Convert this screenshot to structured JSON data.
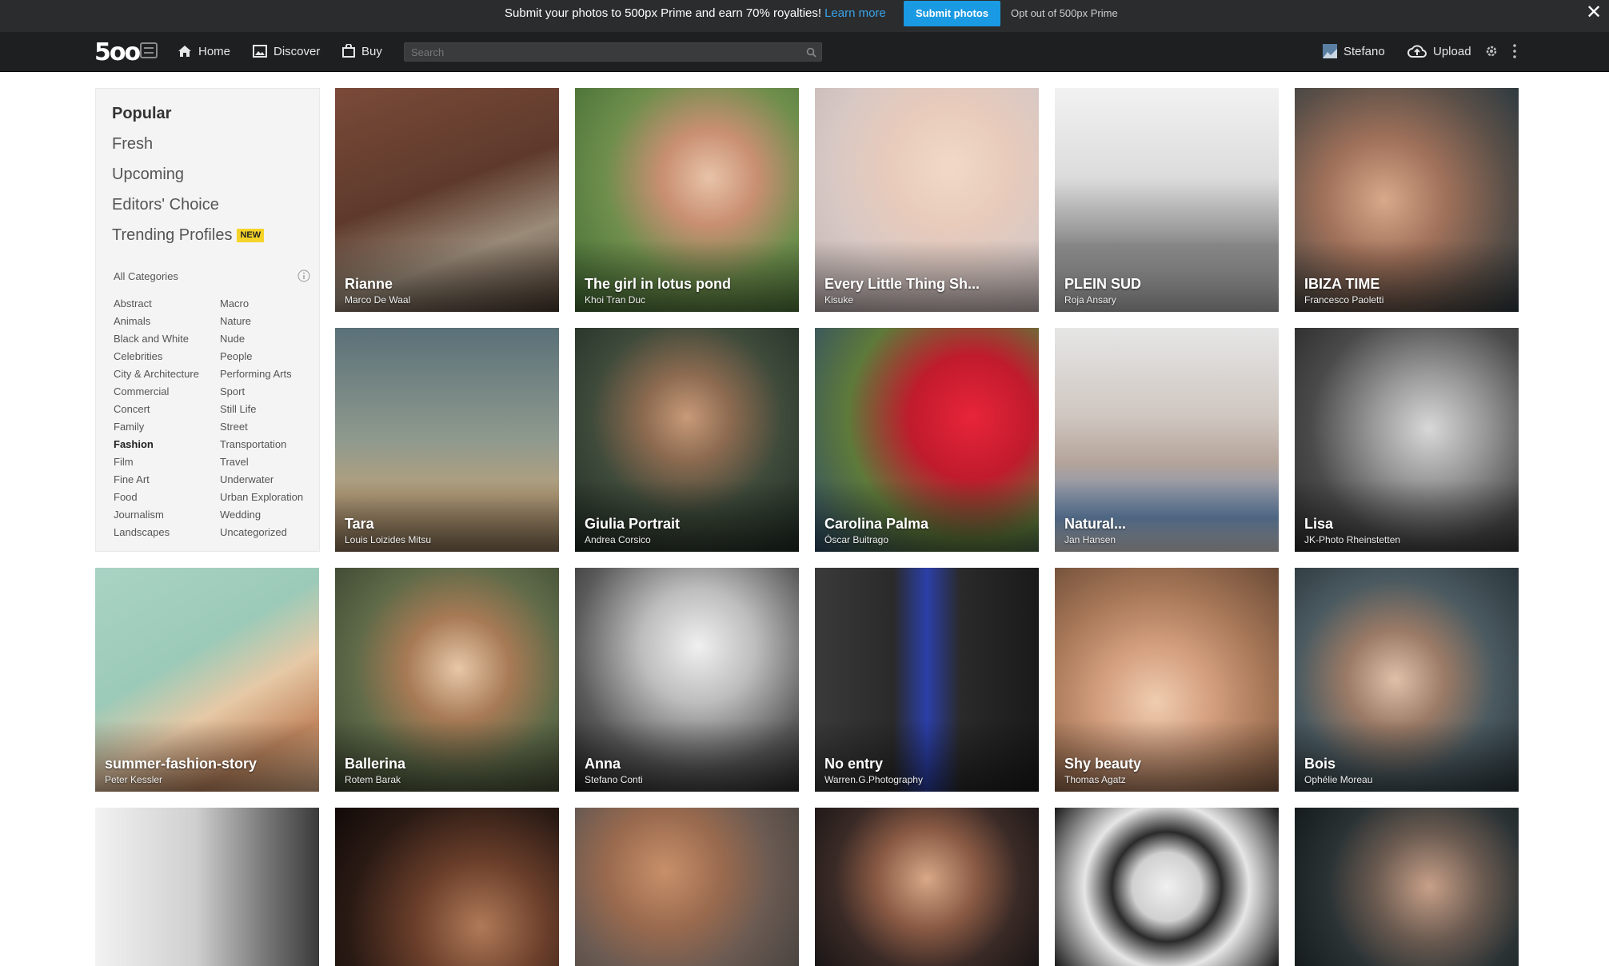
{
  "promo": {
    "text": "Submit your photos to 500px Prime and earn 70% royalties!",
    "link": "Learn more",
    "button": "Submit photos",
    "optout": "Opt out of 500px Prime",
    "close": "✕"
  },
  "nav": {
    "logo": "5oo",
    "home": "Home",
    "discover": "Discover",
    "buy": "Buy",
    "search_placeholder": "Search",
    "user": "Stefano",
    "upload": "Upload"
  },
  "sidebar": {
    "main": [
      "Popular",
      "Fresh",
      "Upcoming",
      "Editors' Choice",
      "Trending Profiles"
    ],
    "new_badge": "NEW",
    "all_categories": "All Categories",
    "col1": [
      "Abstract",
      "Animals",
      "Black and White",
      "Celebrities",
      "City & Architecture",
      "Commercial",
      "Concert",
      "Family",
      "Fashion",
      "Film",
      "Fine Art",
      "Food",
      "Journalism",
      "Landscapes"
    ],
    "col2": [
      "Macro",
      "Nature",
      "Nude",
      "People",
      "Performing Arts",
      "Sport",
      "Still Life",
      "Street",
      "Transportation",
      "Travel",
      "Underwater",
      "Urban Exploration",
      "Wedding",
      "Uncategorized"
    ]
  },
  "photos": [
    {
      "title": "Rianne",
      "author": "Marco De Waal"
    },
    {
      "title": "The girl in lotus pond",
      "author": "Khoi Tran Duc"
    },
    {
      "title": "Every Little Thing Sh...",
      "author": "Kisuke"
    },
    {
      "title": "PLEIN SUD",
      "author": "Roja Ansary"
    },
    {
      "title": "IBIZA TIME",
      "author": "Francesco Paoletti"
    },
    {
      "title": "Tara",
      "author": "Louis Loizides Mitsu"
    },
    {
      "title": "Giulia Portrait",
      "author": "Andrea Corsico"
    },
    {
      "title": "Carolina Palma",
      "author": "Óscar Buitrago"
    },
    {
      "title": "Natural...",
      "author": "Jan Hansen"
    },
    {
      "title": "Lisa",
      "author": "JK-Photo Rheinstetten"
    },
    {
      "title": "summer-fashion-story",
      "author": "Peter Kessler"
    },
    {
      "title": "Ballerina",
      "author": "Rotem Barak"
    },
    {
      "title": "Anna",
      "author": "Stefano Conti"
    },
    {
      "title": "No entry",
      "author": "Warren.G.Photography"
    },
    {
      "title": "Shy beauty",
      "author": "Thomas Agatz"
    },
    {
      "title": "Bois",
      "author": "Ophélie Moreau"
    }
  ],
  "colors": {
    "promo_bg": "#2b2c2e",
    "nav_bg": "#1e1f21",
    "accent": "#1a9ae2",
    "badge": "#f5d328"
  }
}
